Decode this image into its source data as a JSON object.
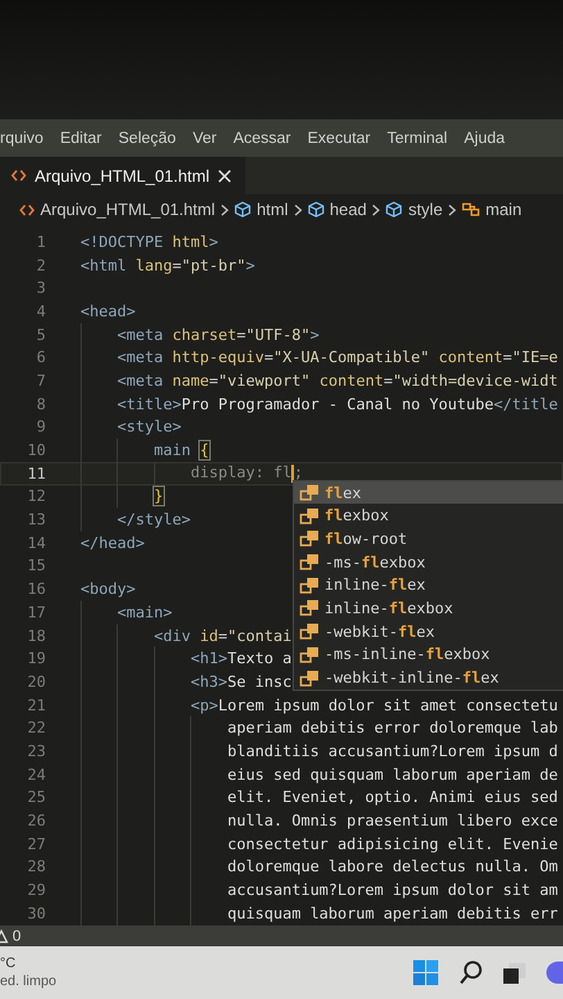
{
  "menu_bar": {
    "items": [
      {
        "label": "rquivo"
      },
      {
        "label": "Editar"
      },
      {
        "label": "Seleção"
      },
      {
        "label": "Ver"
      },
      {
        "label": "Acessar"
      },
      {
        "label": "Executar"
      },
      {
        "label": "Terminal"
      },
      {
        "label": "Ajuda"
      }
    ]
  },
  "tabs": [
    {
      "label": "Arquivo_HTML_01.html",
      "selected": true
    }
  ],
  "breadcrumbs": [
    {
      "label": "Arquivo_HTML_01.html",
      "kind": "file"
    },
    {
      "label": "html",
      "kind": "element"
    },
    {
      "label": "head",
      "kind": "element"
    },
    {
      "label": "style",
      "kind": "element"
    },
    {
      "label": "main",
      "kind": "symbol"
    }
  ],
  "editor": {
    "lines": [
      {
        "number": "1",
        "current": false,
        "tokens": [
          {
            "kind": "tag",
            "text": "<!DOCTYPE"
          },
          {
            "kind": "attr",
            "text": " html"
          },
          {
            "kind": "tag",
            "text": ">"
          }
        ]
      },
      {
        "number": "2",
        "current": false,
        "tokens": [
          {
            "kind": "tag",
            "text": "<html"
          },
          {
            "kind": "attr",
            "text": " lang"
          },
          {
            "kind": "punct",
            "text": "="
          },
          {
            "kind": "string",
            "text": "\"pt-br\""
          },
          {
            "kind": "tag",
            "text": ">"
          }
        ]
      },
      {
        "number": "3",
        "current": false
      },
      {
        "number": "4",
        "current": false,
        "tokens": [
          {
            "kind": "tag",
            "text": "<head>"
          }
        ]
      },
      {
        "number": "5",
        "current": false,
        "tokens": [
          {
            "kind": "tag",
            "text": "    <meta"
          },
          {
            "kind": "attr",
            "text": " charset"
          },
          {
            "kind": "punct",
            "text": "="
          },
          {
            "kind": "string",
            "text": "\"UTF-8\""
          },
          {
            "kind": "tag",
            "text": ">"
          }
        ]
      },
      {
        "number": "6",
        "current": false,
        "tokens": [
          {
            "kind": "tag",
            "text": "    <meta"
          },
          {
            "kind": "attr",
            "text": " http-equiv"
          },
          {
            "kind": "punct",
            "text": "="
          },
          {
            "kind": "string",
            "text": "\"X-UA-Compatible\""
          },
          {
            "kind": "attr",
            "text": " content"
          },
          {
            "kind": "punct",
            "text": "="
          },
          {
            "kind": "string",
            "text": "\"IE=e"
          }
        ]
      },
      {
        "number": "7",
        "current": false,
        "tokens": [
          {
            "kind": "tag",
            "text": "    <meta"
          },
          {
            "kind": "attr",
            "text": " name"
          },
          {
            "kind": "punct",
            "text": "="
          },
          {
            "kind": "string",
            "text": "\"viewport\""
          },
          {
            "kind": "attr",
            "text": " content"
          },
          {
            "kind": "punct",
            "text": "="
          },
          {
            "kind": "string",
            "text": "\"width=device-widt"
          }
        ]
      },
      {
        "number": "8",
        "current": false,
        "tokens": [
          {
            "kind": "tag",
            "text": "    <title>"
          },
          {
            "kind": "text",
            "text": "Pro Programador - Canal no Youtube"
          },
          {
            "kind": "tag",
            "text": "</title"
          }
        ]
      },
      {
        "number": "9",
        "current": false,
        "tokens": [
          {
            "kind": "tag",
            "text": "    <style>"
          }
        ]
      },
      {
        "number": "10",
        "current": false,
        "tokens": [
          {
            "kind": "selector",
            "text": "        main "
          },
          {
            "kind": "brace",
            "text": "{"
          }
        ]
      },
      {
        "number": "11",
        "current": true,
        "tokens": [
          {
            "kind": "prop",
            "text": "            display: fl"
          },
          {
            "kind": "cursor"
          },
          {
            "kind": "prop",
            "text": ";"
          }
        ]
      },
      {
        "number": "12",
        "current": false,
        "tokens": [
          {
            "kind": "brace",
            "text": "        }"
          }
        ]
      },
      {
        "number": "13",
        "current": false,
        "tokens": [
          {
            "kind": "tag",
            "text": "    </style>"
          }
        ]
      },
      {
        "number": "14",
        "current": false,
        "tokens": [
          {
            "kind": "tag",
            "text": "</head>"
          }
        ]
      },
      {
        "number": "15",
        "current": false
      },
      {
        "number": "16",
        "current": false,
        "tokens": [
          {
            "kind": "tag",
            "text": "<body>"
          }
        ]
      },
      {
        "number": "17",
        "current": false,
        "tokens": [
          {
            "kind": "tag",
            "text": "    <main>"
          }
        ]
      },
      {
        "number": "18",
        "current": false,
        "tokens": [
          {
            "kind": "tag",
            "text": "        <div"
          },
          {
            "kind": "attr",
            "text": " id"
          },
          {
            "kind": "punct",
            "text": "="
          },
          {
            "kind": "string",
            "text": "\"contai"
          }
        ]
      },
      {
        "number": "19",
        "current": false,
        "tokens": [
          {
            "kind": "tag",
            "text": "            <h1>"
          },
          {
            "kind": "text",
            "text": "Texto a"
          }
        ]
      },
      {
        "number": "20",
        "current": false,
        "tokens": [
          {
            "kind": "tag",
            "text": "            <h3>"
          },
          {
            "kind": "text",
            "text": "Se insc"
          }
        ]
      },
      {
        "number": "21",
        "current": false,
        "tokens": [
          {
            "kind": "tag",
            "text": "            <p>"
          },
          {
            "kind": "text",
            "text": "Lorem ipsum dolor sit amet consectetu"
          }
        ]
      },
      {
        "number": "22",
        "current": false,
        "tokens": [
          {
            "kind": "text",
            "text": "                aperiam debitis error doloremque lab"
          }
        ]
      },
      {
        "number": "23",
        "current": false,
        "tokens": [
          {
            "kind": "text",
            "text": "                blanditiis accusantium?Lorem ipsum d"
          }
        ]
      },
      {
        "number": "24",
        "current": false,
        "tokens": [
          {
            "kind": "text",
            "text": "                eius sed quisquam laborum aperiam de"
          }
        ]
      },
      {
        "number": "25",
        "current": false,
        "tokens": [
          {
            "kind": "text",
            "text": "                elit. Eveniet, optio. Animi eius sed"
          }
        ]
      },
      {
        "number": "26",
        "current": false,
        "tokens": [
          {
            "kind": "text",
            "text": "                nulla. Omnis praesentium libero exce"
          }
        ]
      },
      {
        "number": "27",
        "current": false,
        "tokens": [
          {
            "kind": "text",
            "text": "                consectetur adipisicing elit. Evenie"
          }
        ]
      },
      {
        "number": "28",
        "current": false,
        "tokens": [
          {
            "kind": "text",
            "text": "                doloremque labore delectus nulla. Om"
          }
        ]
      },
      {
        "number": "29",
        "current": false,
        "tokens": [
          {
            "kind": "text",
            "text": "                accusantium?Lorem ipsum dolor sit am"
          }
        ]
      },
      {
        "number": "30",
        "current": false,
        "tokens": [
          {
            "kind": "text",
            "text": "                quisquam laborum aperiam debitis err"
          }
        ]
      }
    ]
  },
  "suggestions": [
    {
      "label": "**fl**ex",
      "selected": true
    },
    {
      "label": "**fl**exbox",
      "selected": false
    },
    {
      "label": "**fl**ow-root",
      "selected": false
    },
    {
      "label": "-ms-**fl**exbox",
      "selected": false
    },
    {
      "label": "inline-**fl**ex",
      "selected": false
    },
    {
      "label": "inline-**fl**exbox",
      "selected": false
    },
    {
      "label": "-webkit-**fl**ex",
      "selected": false
    },
    {
      "label": "-ms-inline-**fl**exbox",
      "selected": false
    },
    {
      "label": "-webkit-inline-**fl**ex",
      "selected": false
    }
  ],
  "status_bar": {
    "warnings": "0"
  },
  "taskbar": {
    "temperature": "°C",
    "condition": "ed. limpo"
  }
}
